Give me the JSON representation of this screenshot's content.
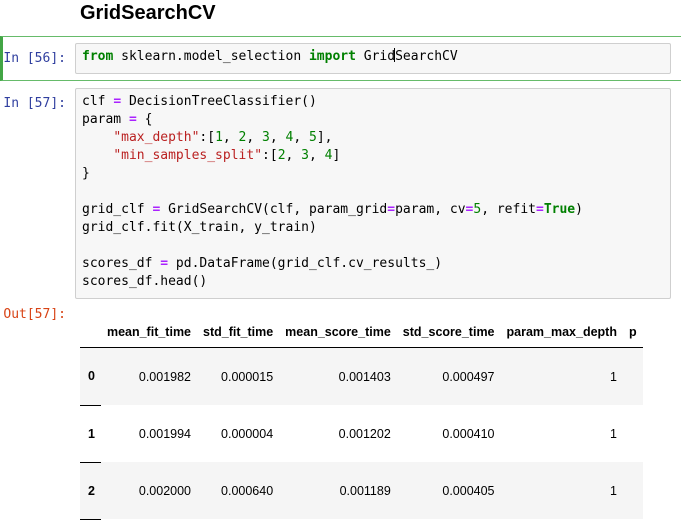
{
  "heading": "GridSearchCV",
  "cells": [
    {
      "prompt": "In [56]:",
      "lines": [
        [
          {
            "t": "from",
            "c": "kw"
          },
          {
            "t": " sklearn.model_selection "
          },
          {
            "t": "import",
            "c": "kw"
          },
          {
            "t": " Grid"
          },
          {
            "cursor": true
          },
          {
            "t": "SearchCV"
          }
        ]
      ]
    },
    {
      "prompt": "In [57]:",
      "lines": [
        [
          {
            "t": "clf "
          },
          {
            "t": "=",
            "c": "op"
          },
          {
            "t": " DecisionTreeClassifier()"
          }
        ],
        [
          {
            "t": "param "
          },
          {
            "t": "=",
            "c": "op"
          },
          {
            "t": " {"
          }
        ],
        [
          {
            "t": "    "
          },
          {
            "t": "\"max_depth\"",
            "c": "str"
          },
          {
            "t": ":["
          },
          {
            "t": "1",
            "c": "num"
          },
          {
            "t": ", "
          },
          {
            "t": "2",
            "c": "num"
          },
          {
            "t": ", "
          },
          {
            "t": "3",
            "c": "num"
          },
          {
            "t": ", "
          },
          {
            "t": "4",
            "c": "num"
          },
          {
            "t": ", "
          },
          {
            "t": "5",
            "c": "num"
          },
          {
            "t": "],"
          }
        ],
        [
          {
            "t": "    "
          },
          {
            "t": "\"min_samples_split\"",
            "c": "str"
          },
          {
            "t": ":["
          },
          {
            "t": "2",
            "c": "num"
          },
          {
            "t": ", "
          },
          {
            "t": "3",
            "c": "num"
          },
          {
            "t": ", "
          },
          {
            "t": "4",
            "c": "num"
          },
          {
            "t": "]"
          }
        ],
        [
          {
            "t": "}"
          }
        ],
        [],
        [
          {
            "t": "grid_clf "
          },
          {
            "t": "=",
            "c": "op"
          },
          {
            "t": " GridSearchCV(clf, param_grid"
          },
          {
            "t": "=",
            "c": "op"
          },
          {
            "t": "param, cv"
          },
          {
            "t": "=",
            "c": "op"
          },
          {
            "t": "5",
            "c": "num"
          },
          {
            "t": ", refit"
          },
          {
            "t": "=",
            "c": "op"
          },
          {
            "t": "True",
            "c": "kw"
          },
          {
            "t": ")"
          }
        ],
        [
          {
            "t": "grid_clf.fit(X_train, y_train)"
          }
        ],
        [],
        [
          {
            "t": "scores_df "
          },
          {
            "t": "=",
            "c": "op"
          },
          {
            "t": " pd.DataFrame(grid_clf.cv_results_)"
          }
        ],
        [
          {
            "t": "scores_df.head()"
          }
        ]
      ]
    }
  ],
  "output_prompt": "Out[57]:",
  "table": {
    "columns": [
      "",
      "mean_fit_time",
      "std_fit_time",
      "mean_score_time",
      "std_score_time",
      "param_max_depth",
      "p"
    ],
    "rows": [
      [
        "0",
        "0.001982",
        "0.000015",
        "0.001403",
        "0.000497",
        "1"
      ],
      [
        "1",
        "0.001994",
        "0.000004",
        "0.001202",
        "0.000410",
        "1"
      ],
      [
        "2",
        "0.002000",
        "0.000640",
        "0.001189",
        "0.000405",
        "1"
      ]
    ]
  },
  "colors": {
    "in_prompt": "#303f9f",
    "out_prompt": "#d84315",
    "selected_border": "#42a545"
  }
}
